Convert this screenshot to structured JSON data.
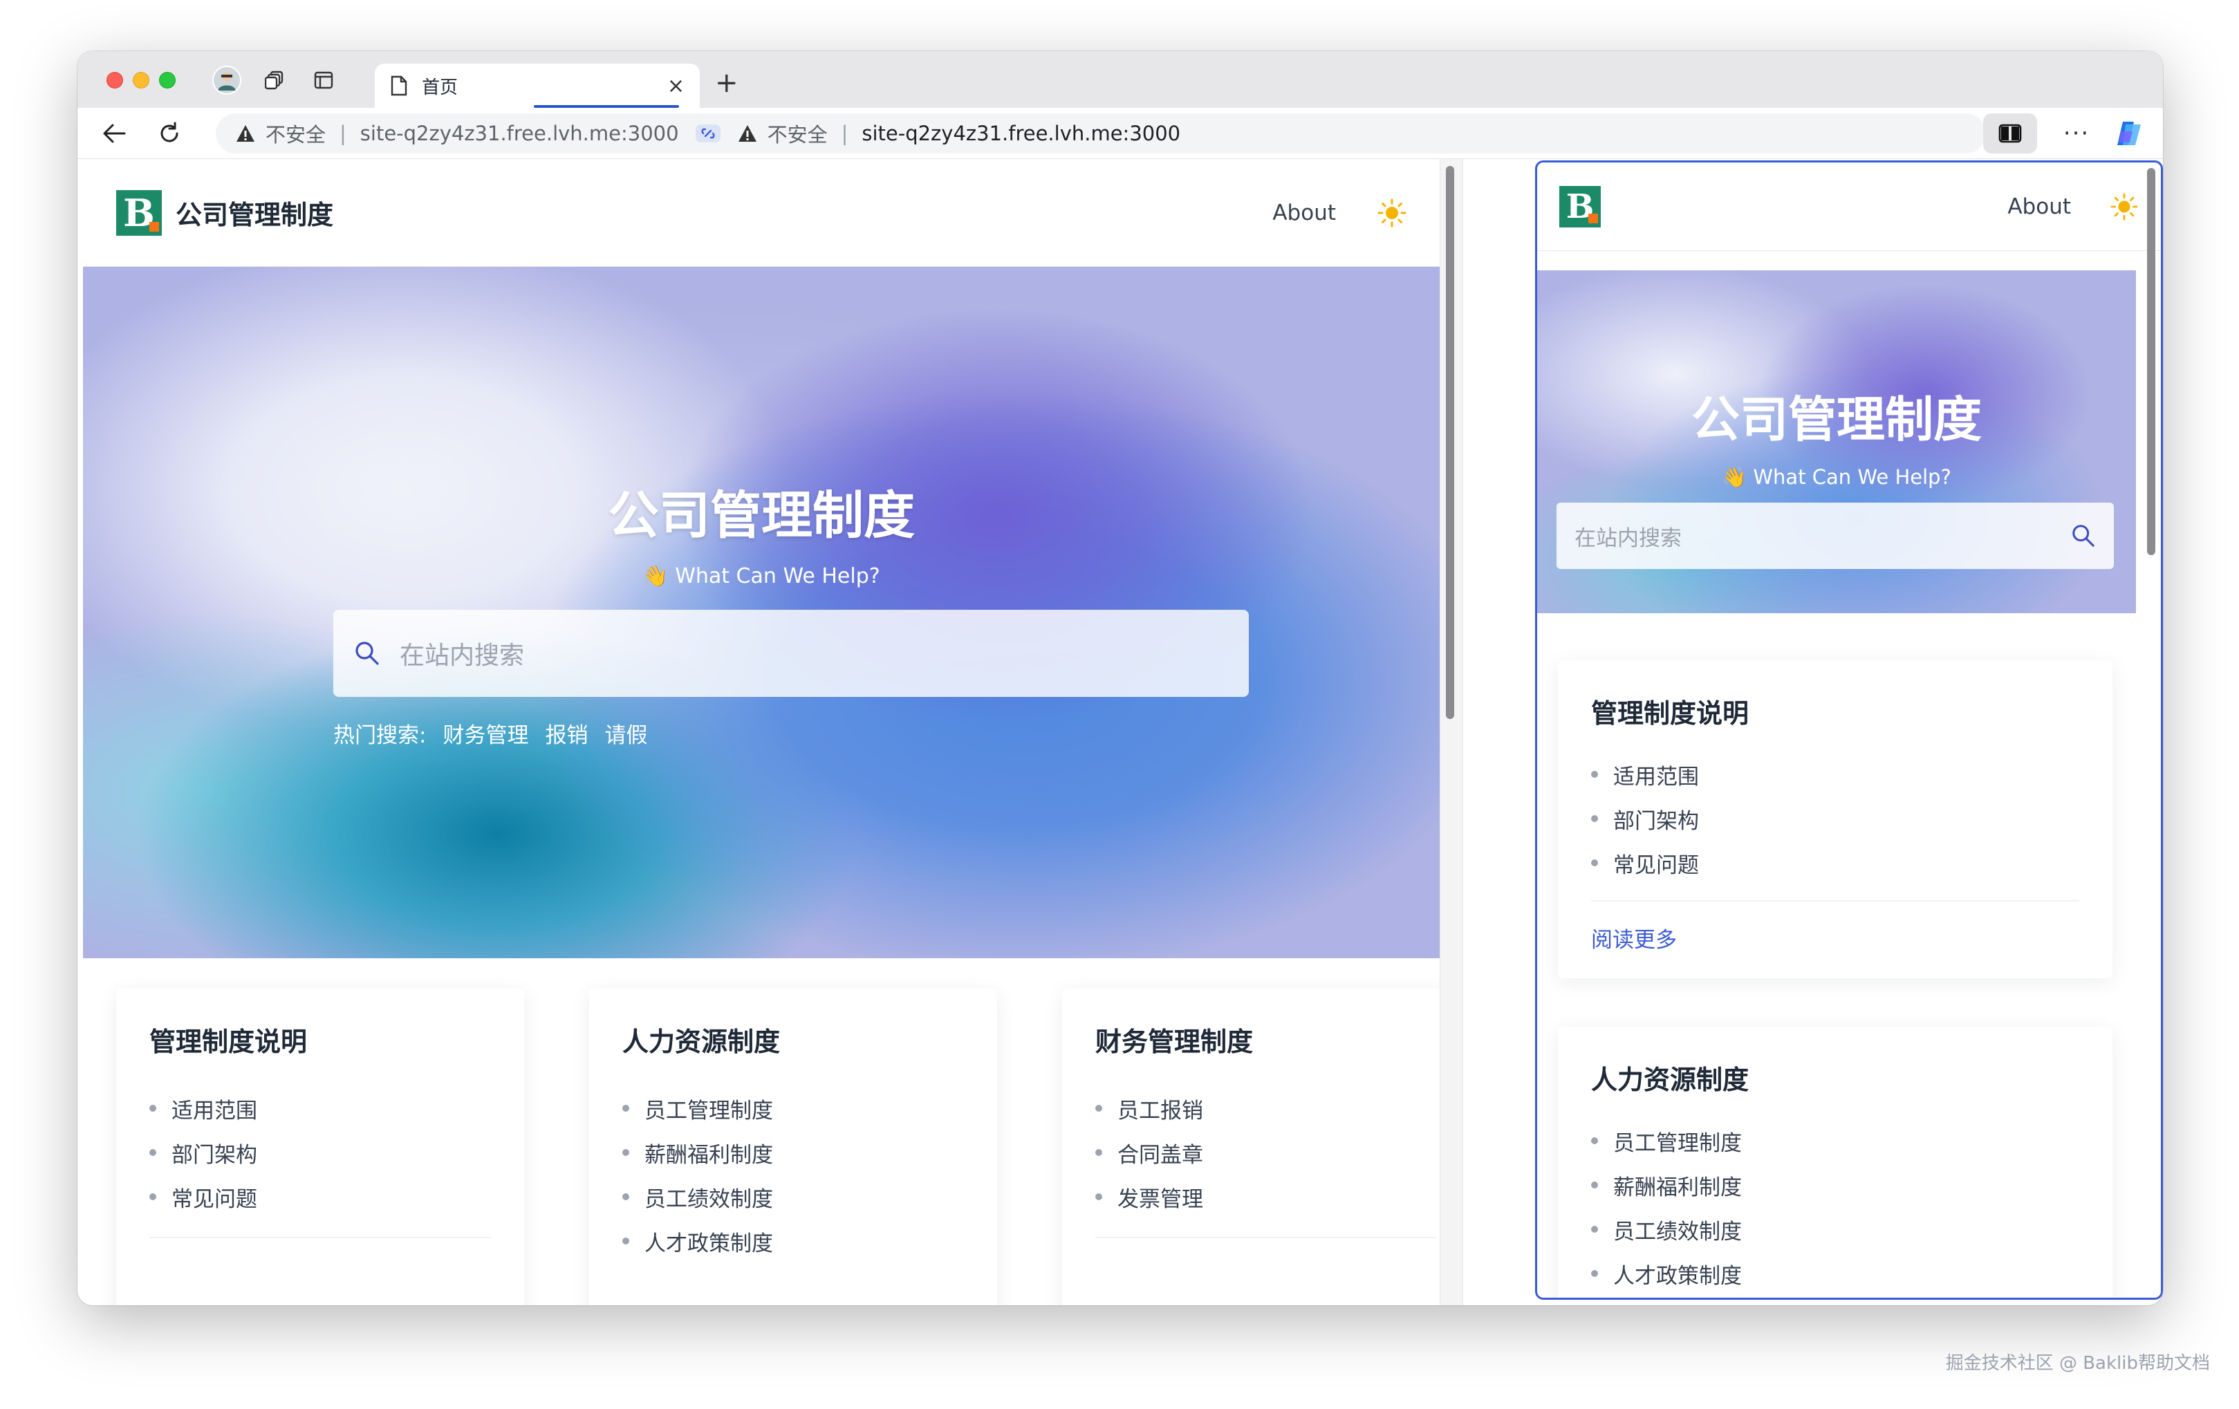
{
  "browser": {
    "tab_title": "首页",
    "omnibox": {
      "security_left": "不安全",
      "origin_left": "site-q2zy4z31.free.lvh.me:3000",
      "security_right": "不安全",
      "url": "site-q2zy4z31.free.lvh.me:3000"
    },
    "icons": {
      "back": "arrow-left-icon",
      "reload": "reload-icon",
      "warning": "warning-icon",
      "link": "link-icon",
      "split": "split-screen-icon",
      "more": "more-icon",
      "copilot": "copilot-icon"
    }
  },
  "site": {
    "title": "公司管理制度",
    "nav_about": "About",
    "hero_title": "公司管理制度",
    "hero_subtitle": "👋 What Can We Help?",
    "search_placeholder": "在站内搜索",
    "hot_label": "热门搜索:",
    "hot_items": [
      "财务管理",
      "报销",
      "请假"
    ],
    "colors": {
      "brand": "#1c8a66",
      "accent": "#f97316",
      "link": "#3b5bd6"
    }
  },
  "cards": [
    {
      "title": "管理制度说明",
      "items": [
        "适用范围",
        "部门架构",
        "常见问题"
      ],
      "more": "阅读更多"
    },
    {
      "title": "人力资源制度",
      "items": [
        "员工管理制度",
        "薪酬福利制度",
        "员工绩效制度",
        "人才政策制度"
      ]
    },
    {
      "title": "财务管理制度",
      "items": [
        "员工报销",
        "合同盖章",
        "发票管理"
      ]
    }
  ],
  "watermark": "掘金技术社区 @ Baklib帮助文档"
}
